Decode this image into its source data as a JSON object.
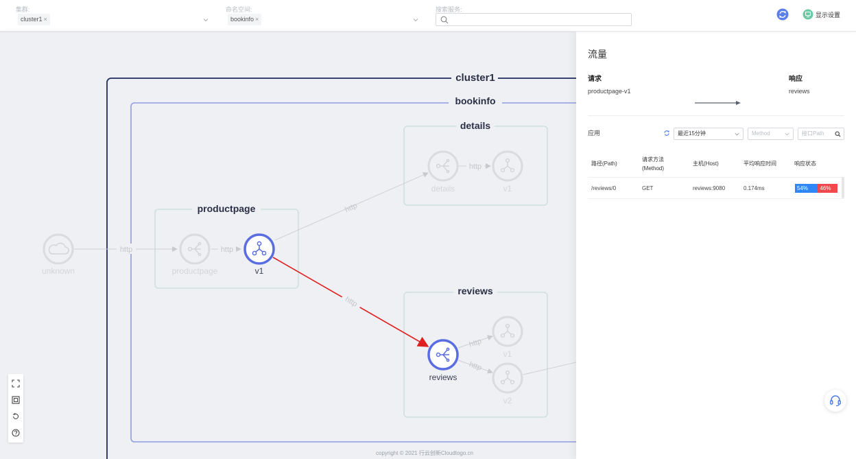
{
  "filters": {
    "cluster": {
      "label": "集群:",
      "tag": "cluster1"
    },
    "namespace": {
      "label": "命名空间:",
      "tag": "bookinfo"
    },
    "search": {
      "label": "搜索服务:",
      "placeholder": ""
    }
  },
  "header": {
    "display_settings": "显示设置"
  },
  "graph": {
    "cluster_title": "cluster1",
    "namespace_title": "bookinfo",
    "boxes": {
      "details": "details",
      "productpage": "productpage",
      "reviews": "reviews"
    },
    "nodes": {
      "unknown": "unknown",
      "productpage_service": "productpage",
      "productpage_v1": "v1",
      "details_service": "details",
      "details_v1": "v1",
      "reviews_service": "reviews",
      "reviews_v1": "v1",
      "reviews_v2": "v2"
    },
    "edge_label": "http",
    "highlight_color": "#e02020",
    "accent_color": "#5b6ee1"
  },
  "toolbar": {
    "icons": [
      "fullscreen-icon",
      "fit-view-icon",
      "reset-icon",
      "help-icon"
    ]
  },
  "copyright": "copyright © 2021 行云创新Cloudtogo.cn",
  "panel": {
    "title": "流量",
    "request_label": "请求",
    "request_value": "productpage-v1",
    "response_label": "响应",
    "response_value": "reviews",
    "app_label": "应用",
    "time_range": "最近15分钟",
    "method_placeholder": "Method",
    "path_placeholder": "接口Path",
    "table": {
      "headers": [
        "路径(Path)",
        "请求方法\n(Method)",
        "主机(Host)",
        "平均响应时间",
        "响应状态"
      ],
      "rows": [
        {
          "path": "/reviews/0",
          "method": "GET",
          "host": "reviews:9080",
          "avg_time": "0.174ms",
          "status_ok": "54%",
          "status_err": "46%",
          "ok_fraction": 0.54
        }
      ]
    },
    "status_colors": {
      "ok": "#2f86f6",
      "err": "#f2484c"
    }
  }
}
